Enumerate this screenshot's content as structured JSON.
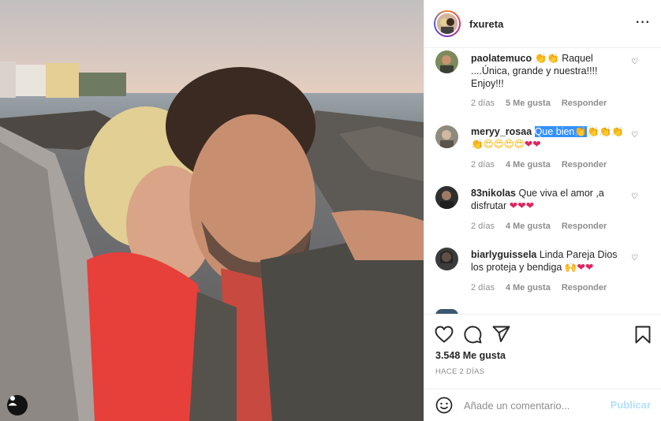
{
  "post": {
    "username": "fxureta",
    "more_icon": "more-horizontal-icon"
  },
  "comments": [
    {
      "user": "paolatemuco",
      "parts": [
        {
          "t": "👏👏",
          "k": "emoji-hand"
        },
        {
          "t": " Raquel ....Única, grande y nuestra!!!! Enjoy!!!",
          "k": ""
        }
      ],
      "age": "2 días",
      "likes": "5 Me gusta",
      "reply": "Responder"
    },
    {
      "user": "meryy_rosaa",
      "parts": [
        {
          "t": "Que bien",
          "k": "highlight"
        },
        {
          "t": "👏",
          "k": "highlight"
        },
        {
          "t": "👏👏👏👏😍😍😍😍",
          "k": "emoji-hand"
        },
        {
          "t": "❤❤",
          "k": "emoji-heart"
        }
      ],
      "age": "2 días",
      "likes": "4 Me gusta",
      "reply": "Responder"
    },
    {
      "user": "83nikolas",
      "parts": [
        {
          "t": "Que viva el amor ,a disfrutar ",
          "k": ""
        },
        {
          "t": "❤❤❤",
          "k": "emoji-heart"
        }
      ],
      "age": "2 días",
      "likes": "4 Me gusta",
      "reply": "Responder"
    },
    {
      "user": "biarlyguissela",
      "parts": [
        {
          "t": "Linda Pareja Dios los proteja y bendiga ",
          "k": ""
        },
        {
          "t": "🙌",
          "k": "emoji-hand"
        },
        {
          "t": "❤❤",
          "k": "emoji-heart"
        }
      ],
      "age": "2 días",
      "likes": "4 Me gusta",
      "reply": "Responder"
    }
  ],
  "actions": {
    "likes_count": "3.548 Me gusta",
    "time_ago": "HACE 2 DÍAS"
  },
  "add_comment": {
    "placeholder": "Añade un comentario...",
    "publish_label": "Publicar"
  },
  "colors": {
    "accent_disabled": "#b2dffc",
    "muted_text": "#8e8e8e",
    "heart": "#e0245e",
    "selection": "#3390ff"
  }
}
